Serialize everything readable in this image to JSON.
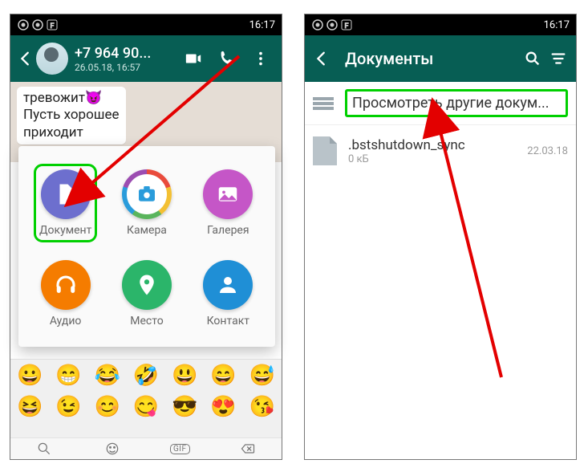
{
  "statusbar": {
    "time": "16:17"
  },
  "left": {
    "header": {
      "title": "+7 964 90...",
      "subtitle": "26.05.18, 16:57"
    },
    "chat": {
      "line1": "тревожит😈",
      "line2": "Пусть хорошее",
      "line3": "приходит"
    },
    "sheet": {
      "document": "Документ",
      "camera": "Камера",
      "gallery": "Галерея",
      "audio": "Аудио",
      "location": "Место",
      "contact": "Контакт"
    },
    "emoji": [
      "😀",
      "😁",
      "😂",
      "🤣",
      "😃",
      "😄",
      "😅",
      "😆",
      "😉",
      "😊",
      "😋",
      "😎",
      "😍",
      "😘"
    ],
    "footer": {
      "gif": "GIF"
    }
  },
  "right": {
    "header": {
      "title": "Документы"
    },
    "browse": "Просмотреть другие докум...",
    "file": {
      "name": ".bstshutdown_sync",
      "size": "0 кБ",
      "date": "22.03.18"
    }
  },
  "colors": {
    "doc": "#6d6fce",
    "camera_ring": "conic-gradient(#e94b3c 0 72deg,#f3c033 72deg 144deg,#5ab55c 144deg 216deg,#2a9cdb 216deg 288deg,#9c4db1 288deg 360deg)",
    "gallery": "#c556c7",
    "audio": "#f57c00",
    "location": "#2bb56a",
    "contact": "#1f8fd6"
  }
}
